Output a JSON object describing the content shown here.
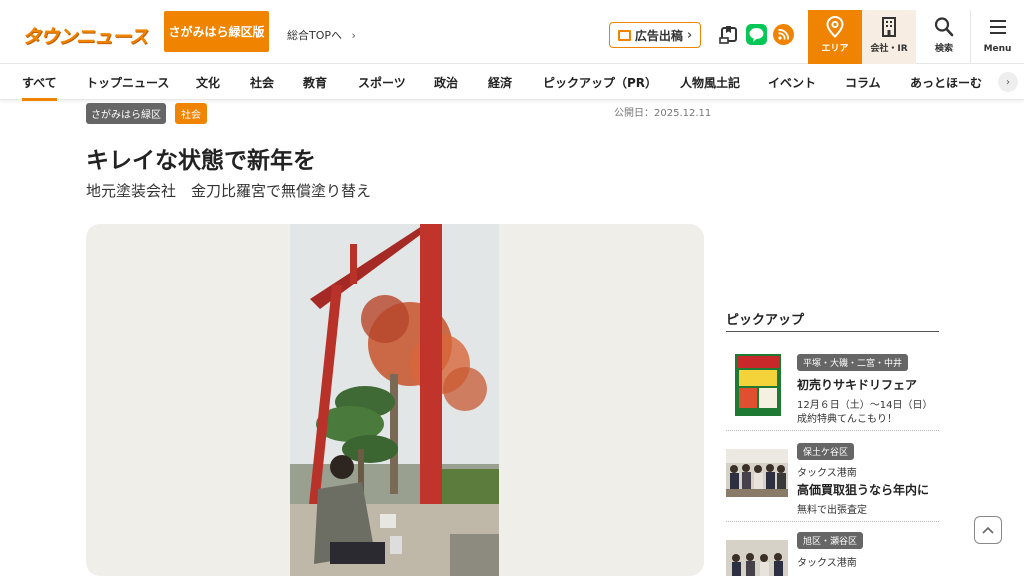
{
  "header": {
    "logo_text": "タウンニュース",
    "edition_label": "さがみはら緑区版",
    "sogo_top_label": "総合TOPへ",
    "ad_label": "広告出稿",
    "area_label": "エリア",
    "ir_label": "会社・IR",
    "search_label": "検索",
    "menu_label": "Menu"
  },
  "nav": {
    "items": [
      "すべて",
      "トップニュース",
      "文化",
      "社会",
      "教育",
      "スポーツ",
      "政治",
      "経済",
      "ピックアップ（PR）",
      "人物風土記",
      "イベント",
      "コラム",
      "あっとほーむ"
    ]
  },
  "article": {
    "tag_area": "さがみはら緑区",
    "tag_category": "社会",
    "pubdate": "公開日：2025.12.11",
    "title": "キレイな状態で新年を",
    "subtitle": "地元塗装会社　金刀比羅宮で無償塗り替え"
  },
  "sidebar": {
    "heading": "ピックアップ",
    "items": [
      {
        "tag": "平塚・大磯・二宮・中井",
        "title": "初売りサキドリフェア",
        "line1": "12月６日（土）～14日（日）",
        "line2": "成約特典てんこもり！"
      },
      {
        "tag": "保土ケ谷区",
        "small": "タックス港南",
        "title": "高価買取狙うなら年内に",
        "line2": "無料で出張査定"
      },
      {
        "tag": "旭区・瀬谷区",
        "small": "タックス港南"
      }
    ]
  },
  "colors": {
    "accent": "#f08300",
    "line_green": "#06c755"
  }
}
